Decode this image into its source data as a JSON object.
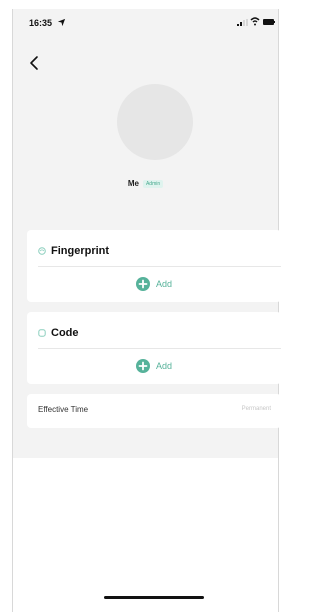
{
  "status_bar": {
    "time": "16:35",
    "icons": [
      "location-arrow-icon",
      "signal-icon",
      "wifi-icon",
      "battery-icon"
    ]
  },
  "navigation": {
    "back_icon": "chevron-left-icon"
  },
  "profile": {
    "name": "Me",
    "role_badge": "Admin"
  },
  "cards": {
    "fingerprint": {
      "title": "Fingerprint",
      "icon": "fingerprint-icon",
      "add_label": "Add"
    },
    "code": {
      "title": "Code",
      "icon": "code-icon",
      "add_label": "Add"
    }
  },
  "effective_time": {
    "label": "Effective Time",
    "value": "Permanent"
  },
  "colors": {
    "accent": "#56b29a",
    "background": "#f3f3f3",
    "card": "#ffffff",
    "avatar": "#e6e6e6"
  }
}
